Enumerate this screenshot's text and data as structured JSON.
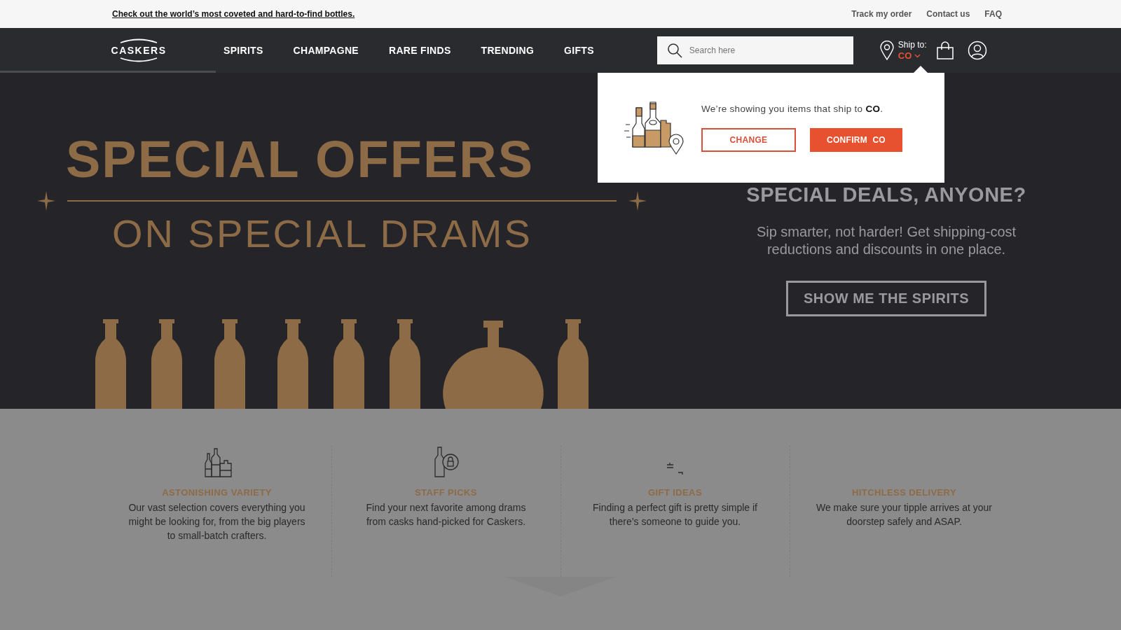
{
  "promo_bar": {
    "link": "Check out the world’s most coveted and hard-to-find bottles.",
    "links": [
      "Track my order",
      "Contact us",
      "FAQ"
    ]
  },
  "header": {
    "logo": "CASKERS",
    "nav": [
      {
        "label": "SPIRITS"
      },
      {
        "label": "CHAMPAGNE"
      },
      {
        "label": "RARE FINDS"
      },
      {
        "label": "TRENDING"
      },
      {
        "label": "GIFTS"
      }
    ],
    "search": {
      "placeholder": "Search here"
    },
    "ship_to": {
      "label": "Ship to:",
      "value": "CO"
    }
  },
  "popup": {
    "message": "We’re showing you items that ship to **CO**.",
    "buttons": [
      {
        "label": "CHANGE",
        "kind": "outline"
      },
      {
        "label": "CONFIRM  CO",
        "kind": "solid"
      }
    ]
  },
  "hero": {
    "banner": {
      "title": "SPECIAL OFFERS",
      "subtitle": "ON SPECIAL DRAMS"
    },
    "heading": "SPECIAL DEALS, ANYONE?",
    "text": "Sip smarter, not harder! Get shipping-cost reductions and discounts in one place.",
    "button": "SHOW ME THE SPIRITS"
  },
  "features": [
    {
      "kind": "bottles",
      "title": "ASTONISHING VARIETY",
      "text": "Our vast selection covers everything you might be looking for, from the big players to small-batch crafters."
    },
    {
      "kind": "bottle-lock",
      "title": "STAFF PICKS",
      "text": "Find your next favorite among drams from casks hand-picked for Caskers."
    },
    {
      "kind": "marks",
      "title": "GIFT IDEAS",
      "text": "Finding a perfect gift is pretty simple if there’s someone to guide you."
    },
    {
      "title": "HITCHLESS DELIVERY",
      "text": "We make sure your tipple arrives at your doorstep safely and ASAP."
    }
  ]
}
